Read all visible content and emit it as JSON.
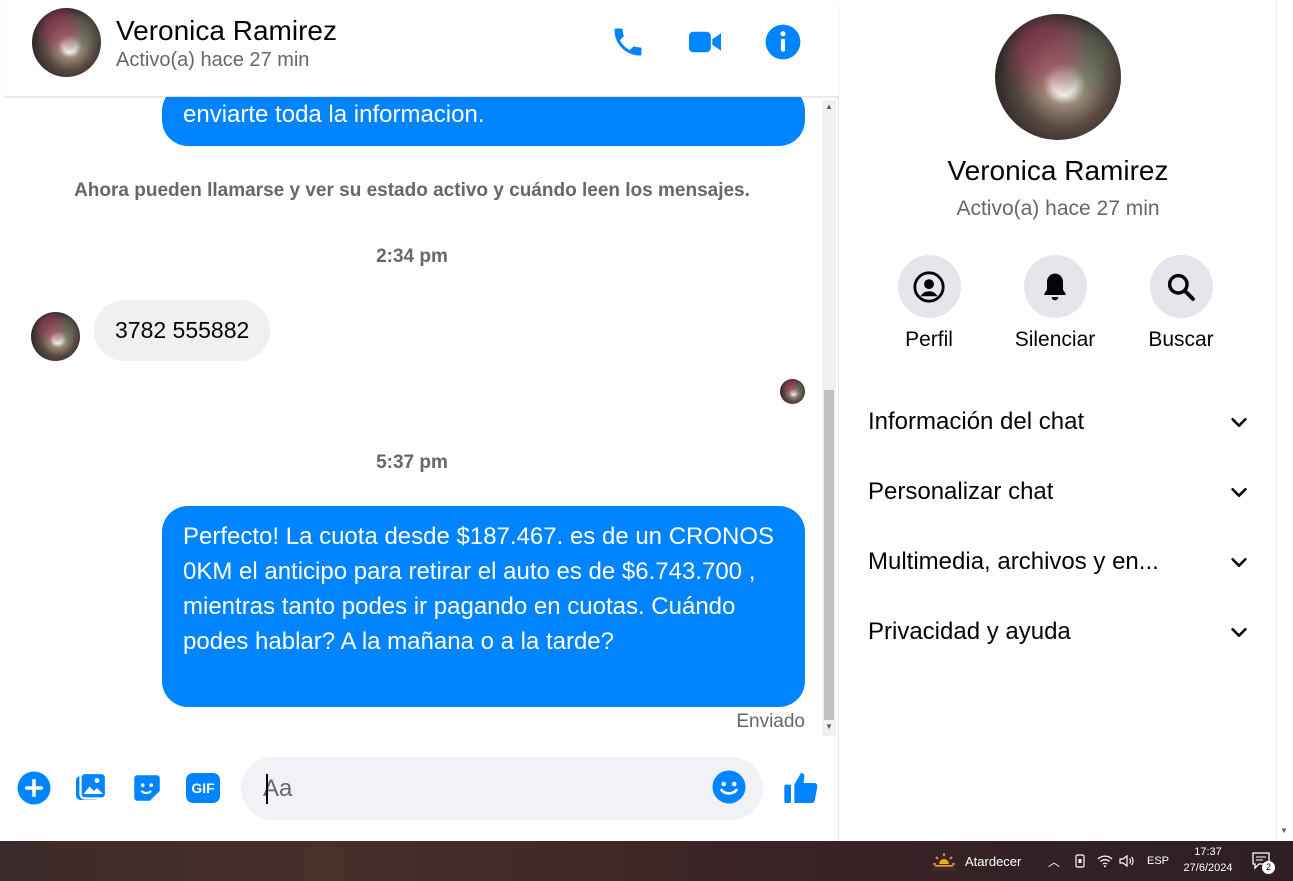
{
  "contact": {
    "name": "Veronica Ramirez",
    "status": "Activo(a) hace 27 min"
  },
  "header_icons": [
    "phone-icon",
    "video-camera-icon",
    "info-icon"
  ],
  "thread": {
    "partial_outgoing_text": "enviarte toda la informacion.",
    "system_note": "Ahora pueden llamarse y ver su estado activo y cuándo leen los mensajes.",
    "timestamp_1": "2:34 pm",
    "incoming_message": "3782 555882",
    "timestamp_2": "5:37 pm",
    "outgoing_message": "Perfecto! La cuota desde $187.467. es de un CRONOS 0KM el anticipo para retirar el auto es de $6.743.700 , mientras tanto podes ir pagando en cuotas. Cuándo podes hablar? A la mañana o a la tarde?",
    "delivery_status": "Enviado"
  },
  "composer": {
    "placeholder": "Aa",
    "gif_label": "GIF"
  },
  "side_panel": {
    "actions": [
      {
        "label": "Perfil",
        "icon": "profile-icon"
      },
      {
        "label": "Silenciar",
        "icon": "bell-icon"
      },
      {
        "label": "Buscar",
        "icon": "search-icon"
      }
    ],
    "sections": [
      {
        "label": "Información del chat"
      },
      {
        "label": "Personalizar chat"
      },
      {
        "label": "Multimedia, archivos y en..."
      },
      {
        "label": "Privacidad y ayuda"
      }
    ]
  },
  "taskbar": {
    "weather_label": "Atardecer",
    "language": "ESP",
    "time": "17:37",
    "date": "27/6/2024",
    "notification_count": "2"
  },
  "colors": {
    "accent": "#0084ff",
    "incoming_bubble": "#f0f0f0",
    "muted_text": "#65676b"
  }
}
